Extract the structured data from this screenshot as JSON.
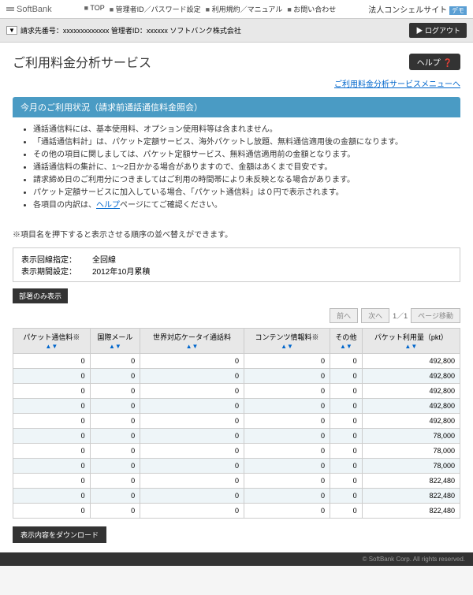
{
  "nav": {
    "logo": "SoftBank",
    "links": [
      "TOP",
      "管理者ID／パスワード設定",
      "利用規約／マニュアル",
      "お問い合わせ"
    ],
    "corp": "法人コンシェルサイト",
    "demo": "デモ"
  },
  "sub": {
    "billing": "請求先番号：xxxxxxxxxxxxx 管理者ID：xxxxxx ソフトバンク株式会社",
    "logout": "▶ ログアウト"
  },
  "title": "ご利用料金分析サービス",
  "help": "ヘルプ ❓",
  "menu_link": "ご利用料金分析サービスメニューへ",
  "section": "今月のご利用状況（請求前通話通信料金照会）",
  "notes": [
    "通話通信料には、基本使用料、オプション使用料等は含まれません。",
    "「通話通信料計」は、パケット定額サービス、海外パケットし放題、無料通信適用後の金額になります。",
    "その他の項目に関しましては、パケット定額サービス、無料通信適用前の金額となります。",
    "通話通信料の集計に、1～2日かかる場合がありますので、金額はあくまで目安です。",
    "請求締め日のご利用分につきましてはご利用の時間帯により未反映となる場合があります。",
    "パケット定額サービスに加入している場合、「パケット通信料」は０円で表示されます。"
  ],
  "red_note_pre": "各項目の内訳は、",
  "red_note_link": "ヘルプ",
  "red_note_post": "ページにてご確認ください。",
  "sub_note": "※項目名を押下すると表示させる順序の並べ替えができます。",
  "settings": {
    "line_label": "表示回線指定：",
    "line_val": "全回線",
    "period_label": "表示期間設定：",
    "period_val": "2012年10月累積"
  },
  "dept_btn": "部署のみ表示",
  "pager": {
    "prev": "前へ",
    "next": "次へ",
    "page": "1／1",
    "move": "ページ移動"
  },
  "headers": [
    "パケット通信料",
    "国際メール",
    "世界対応ケータイ通話料",
    "コンテンツ情報料",
    "その他",
    "パケット利用量（pkt）"
  ],
  "sort": "▲▼",
  "rows": [
    [
      "0",
      "0",
      "0",
      "0",
      "0",
      "492,800"
    ],
    [
      "0",
      "0",
      "0",
      "0",
      "0",
      "492,800"
    ],
    [
      "0",
      "0",
      "0",
      "0",
      "0",
      "492,800"
    ],
    [
      "0",
      "0",
      "0",
      "0",
      "0",
      "492,800"
    ],
    [
      "0",
      "0",
      "0",
      "0",
      "0",
      "492,800"
    ],
    [
      "0",
      "0",
      "0",
      "0",
      "0",
      "78,000"
    ],
    [
      "0",
      "0",
      "0",
      "0",
      "0",
      "78,000"
    ],
    [
      "0",
      "0",
      "0",
      "0",
      "0",
      "78,000"
    ],
    [
      "0",
      "0",
      "0",
      "0",
      "0",
      "822,480"
    ],
    [
      "0",
      "0",
      "0",
      "0",
      "0",
      "822,480"
    ],
    [
      "0",
      "0",
      "0",
      "0",
      "0",
      "822,480"
    ]
  ],
  "download": "表示内容をダウンロード",
  "footer": "© SoftBank Corp. All rights reserved."
}
